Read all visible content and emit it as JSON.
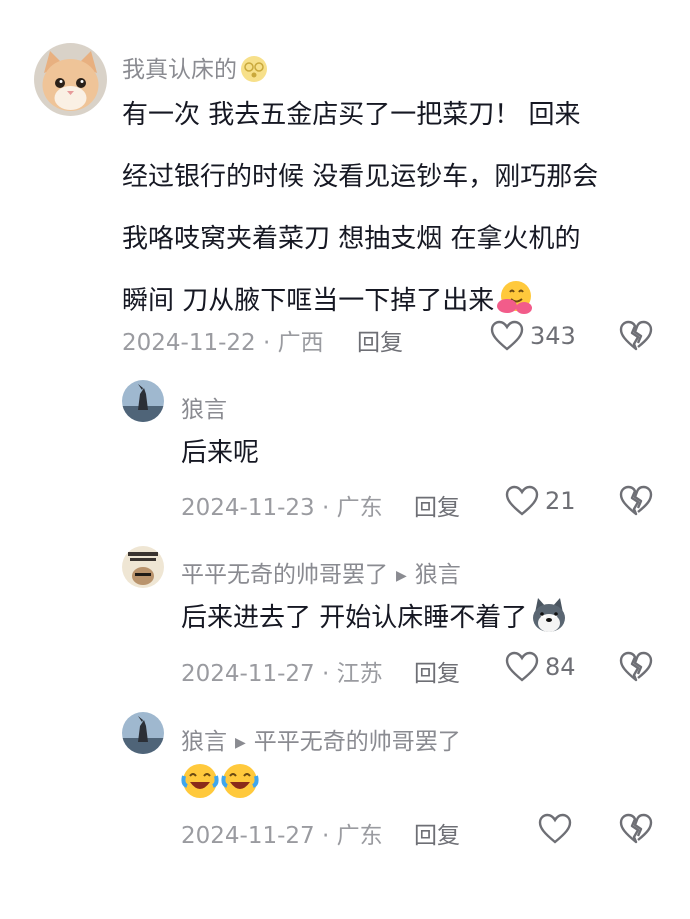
{
  "comments": [
    {
      "name": "我真认床的",
      "lines": [
        "有一次  我去五金店买了一把菜刀！  回来",
        "经过银行的时候  没看见运钞车，刚巧那会",
        "我咯吱窝夹着菜刀   想抽支烟  在拿火机的",
        "瞬间  刀从腋下哐当一下掉了出来"
      ],
      "meta": "2024-11-22 · 广西",
      "reply": "回复",
      "likes": "343"
    },
    {
      "name": "狼言",
      "text": "后来呢",
      "meta": "2024-11-23 · 广东",
      "reply": "回复",
      "likes": "21"
    },
    {
      "name": "平平无奇的帅哥罢了",
      "reply_to": "狼言",
      "text": "后来进去了 开始认床睡不着了",
      "meta": "2024-11-27 · 江苏",
      "reply": "回复",
      "likes": "84"
    },
    {
      "name": "狼言",
      "reply_to": "平平无奇的帅哥罢了",
      "meta": "2024-11-27 · 广东",
      "reply": "回复",
      "likes": ""
    }
  ]
}
